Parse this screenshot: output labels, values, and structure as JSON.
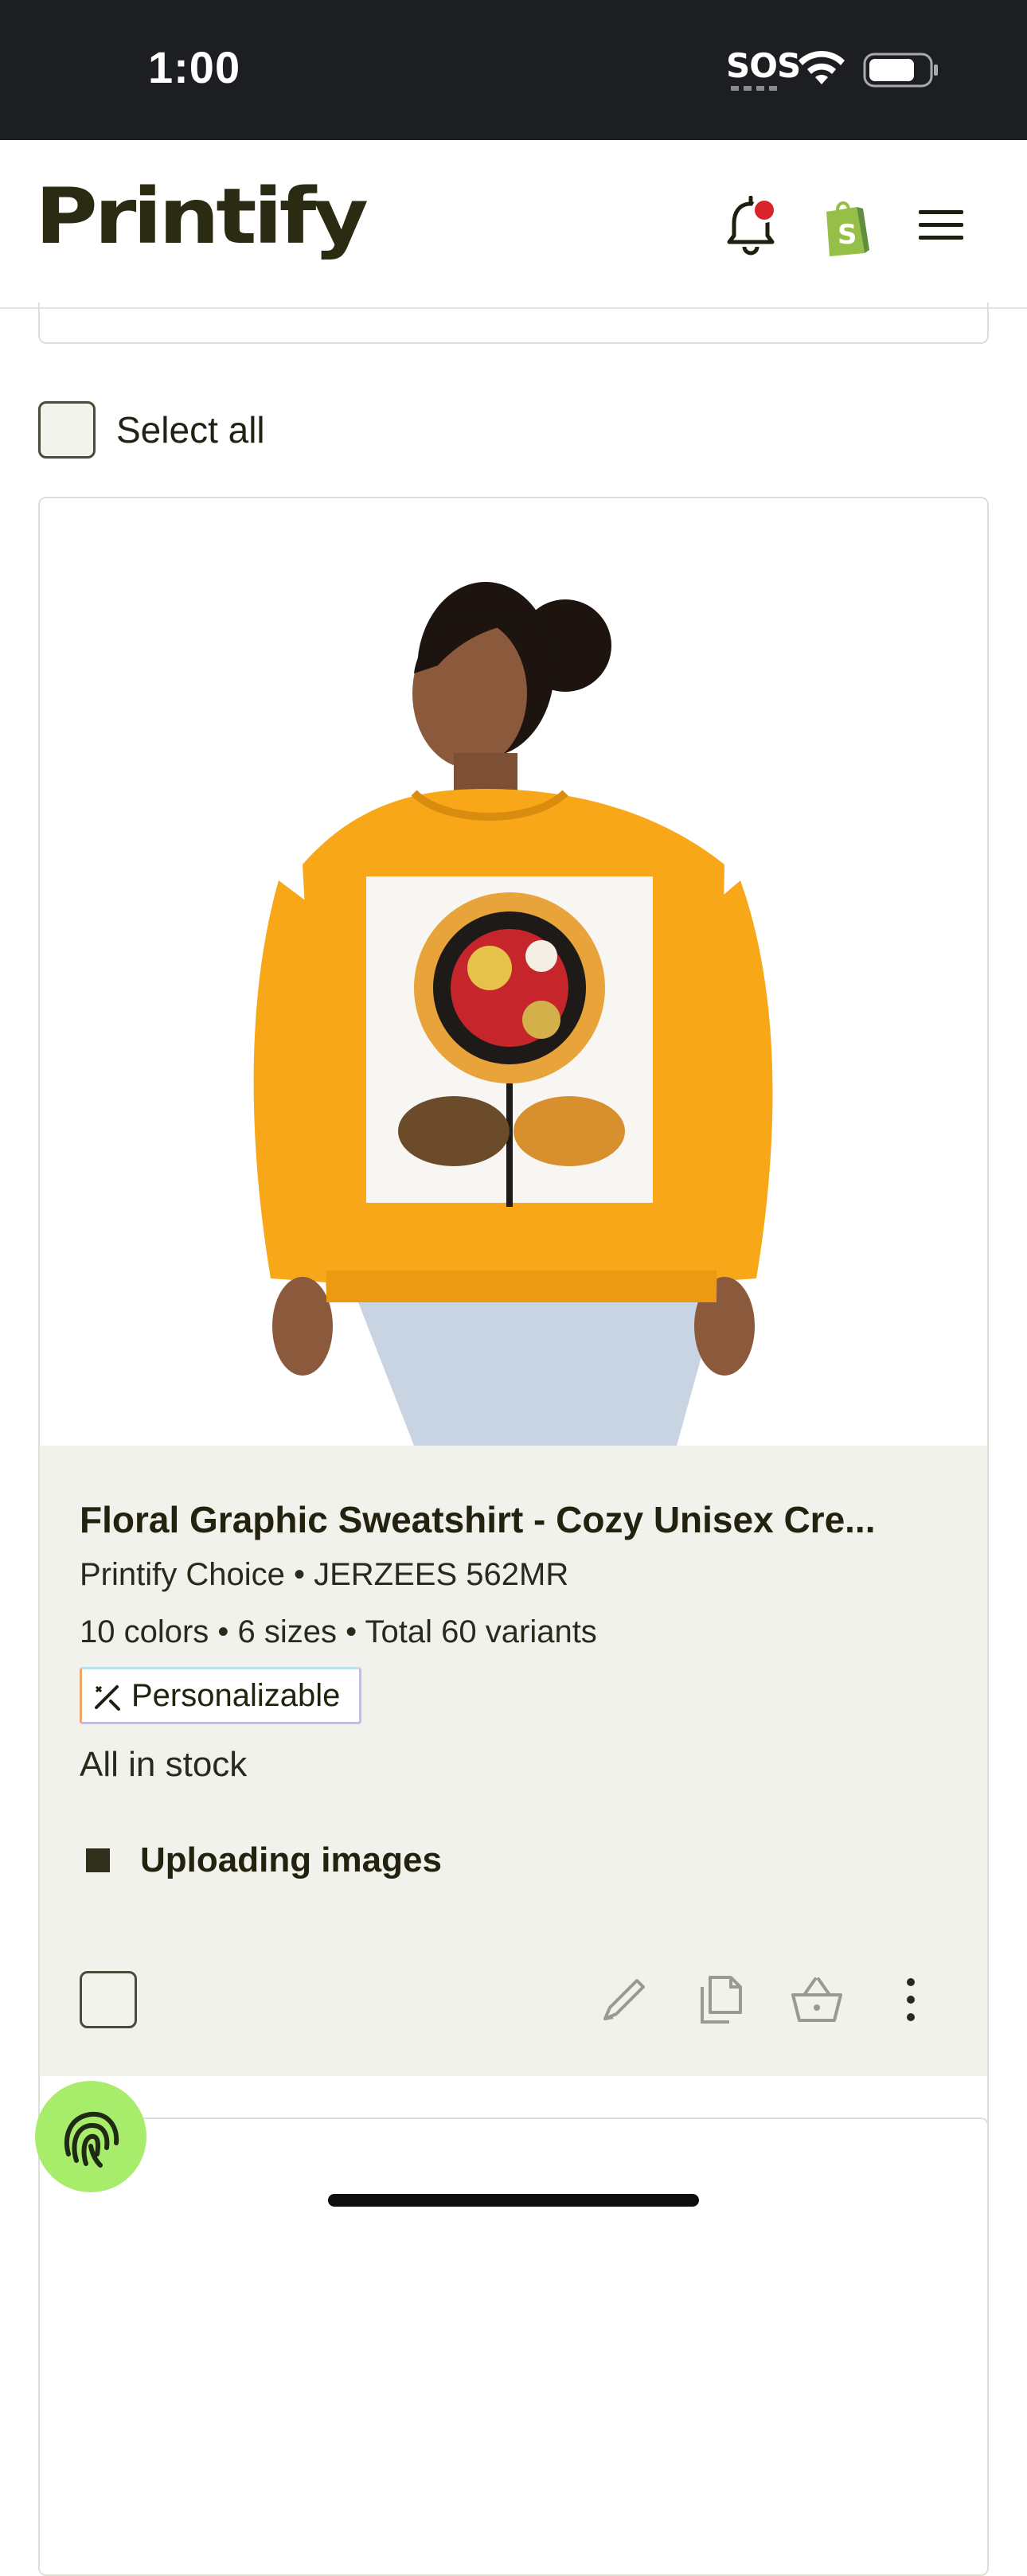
{
  "status_bar": {
    "time": "1:00",
    "sos": "SOS"
  },
  "header": {
    "brand": "Printify",
    "icons": [
      "bell-icon",
      "shopify-icon",
      "hamburger-menu-icon"
    ],
    "notification_dot_color": "#d8242a",
    "shopify_color": "#8db53f"
  },
  "list": {
    "select_all_label": "Select all"
  },
  "product": {
    "title": "Floral Graphic Sweatshirt - Cozy Unisex Cre...",
    "provider": "Printify Choice • JERZEES 562MR",
    "variants": "10 colors • 6 sizes • Total 60 variants",
    "badge": "Personalizable",
    "stock": "All in stock",
    "upload_status": "Uploading images",
    "actions": [
      "pencil-icon",
      "duplicate-icon",
      "publish-basket-icon",
      "more-vertical-icon"
    ]
  },
  "fab": {
    "icon": "fingerprint-icon",
    "color": "#a8ec6c"
  },
  "colors": {
    "status_bar_bg": "#1c1e22",
    "card_info_bg": "#f2f2ed",
    "sweatshirt": "#f7a718"
  }
}
